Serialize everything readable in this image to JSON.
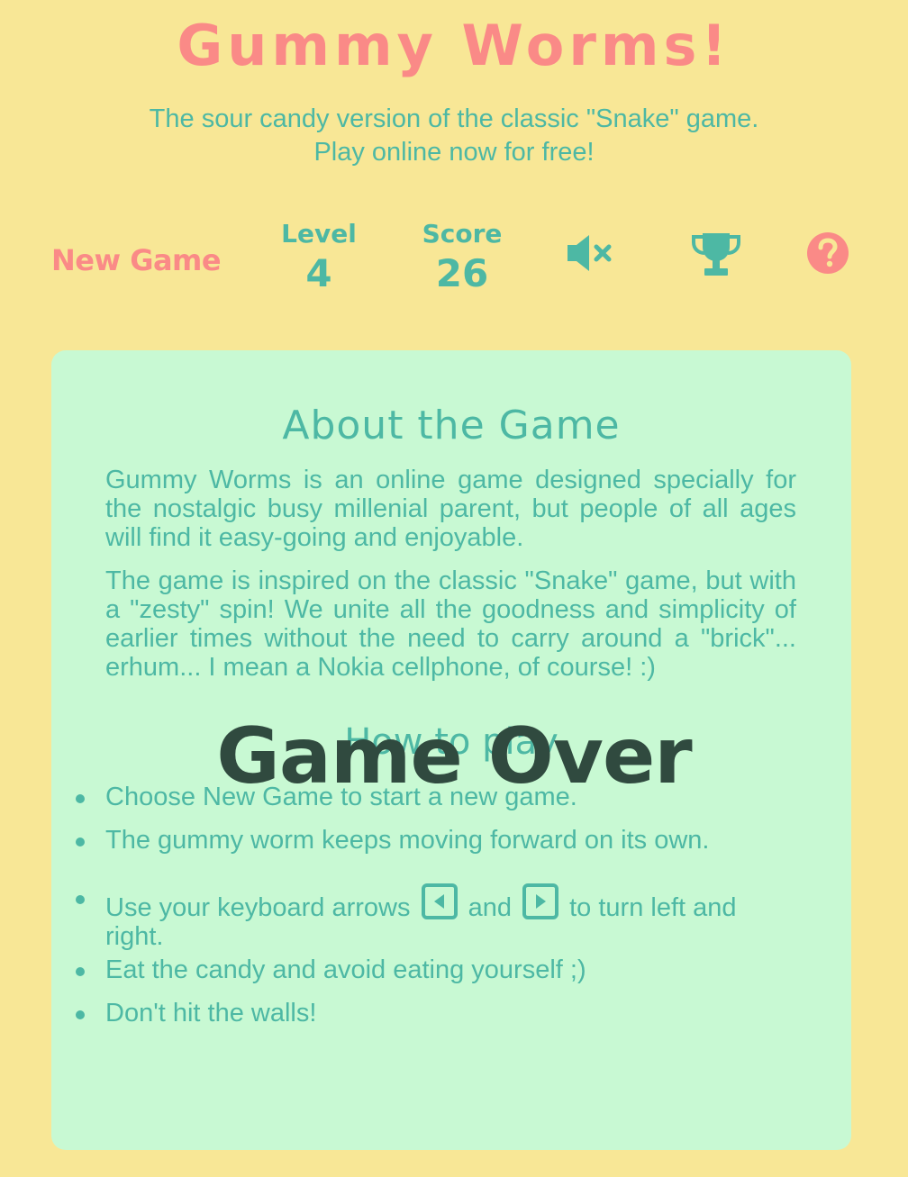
{
  "header": {
    "title": "Gummy Worms!",
    "subtitle_line1": "The sour candy version of the classic \"Snake\" game.",
    "subtitle_line2": "Play online now for free!"
  },
  "toolbar": {
    "new_game_label": "New Game",
    "level_label": "Level",
    "level_value": "4",
    "score_label": "Score",
    "score_value": "26",
    "sound_icon": "speaker-muted-icon",
    "leaderboard_icon": "trophy-icon",
    "help_icon": "question-circle-icon"
  },
  "about": {
    "heading": "About the Game",
    "paragraphs": [
      "Gummy Worms is an online game designed specially for the nostalgic busy millenial parent, but people of all ages will find it easy-going and enjoyable.",
      "The game is inspired on the classic \"Snake\" game, but with a \"zesty\" spin! We unite all the goodness and simplicity of earlier times without the need to carry around a \"brick\"... erhum... I mean a Nokia cellphone, of course! :)"
    ]
  },
  "how_to_play": {
    "heading": "How to play",
    "rules": [
      "Choose New Game to start a new game.",
      "The gummy worm keeps moving forward on its own.",
      {
        "part1": "Use your keyboard arrows",
        "part2": "and",
        "part3": "to turn left and right.",
        "left_key_icon": "arrow-left-key-icon",
        "right_key_icon": "arrow-right-key-icon"
      },
      "Eat the candy and avoid eating yourself ;)",
      "Don't hit the walls!"
    ]
  },
  "overlay": {
    "game_over_text": "Game Over"
  },
  "colors": {
    "background": "#f8e796",
    "accent_pink": "#fa8a87",
    "accent_teal": "#4db8a4",
    "panel": "#c8f9d3",
    "overlay_text": "#304a3f"
  }
}
